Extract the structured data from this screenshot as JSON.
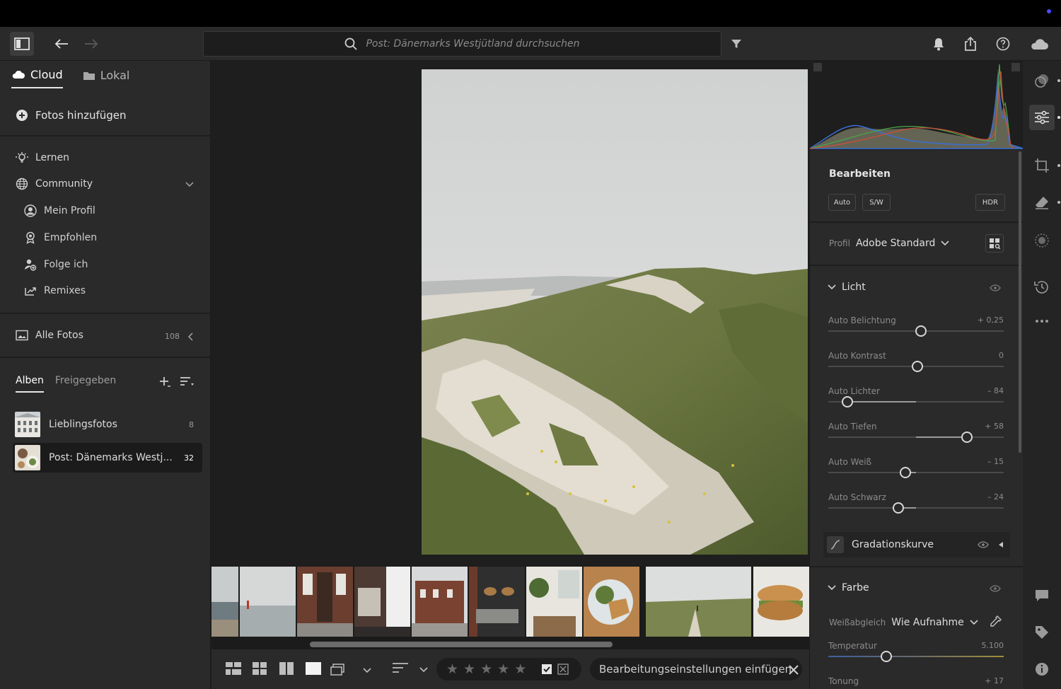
{
  "toolbar": {
    "search_placeholder": "Post: Dänemarks Westjütland durchsuchen"
  },
  "left": {
    "tabs": [
      {
        "label": "Cloud",
        "icon": "cloud-icon",
        "active": true
      },
      {
        "label": "Lokal",
        "icon": "folder-icon",
        "active": false
      }
    ],
    "add_photos": "Fotos hinzufügen",
    "nav": {
      "learn": "Lernen",
      "community": "Community",
      "my_profile": "Mein Profil",
      "recommended": "Empfohlen",
      "following": "Folge ich",
      "remixes": "Remixes",
      "all_photos": "Alle Fotos",
      "all_photos_count": "108"
    },
    "album_tabs": [
      "Alben",
      "Freigegeben"
    ],
    "albums": [
      {
        "name": "Lieblingsfotos",
        "count": "8"
      },
      {
        "name": "Post: Dänemarks Westj...",
        "count": "32"
      }
    ]
  },
  "edit": {
    "title": "Bearbeiten",
    "auto_btn": "Auto",
    "bw_btn": "S/W",
    "hdr_btn": "HDR",
    "profile_label": "Profil",
    "profile_value": "Adobe Standard",
    "light": {
      "title": "Licht",
      "sliders": [
        {
          "label": "Auto Belichtung",
          "value": "+ 0,25",
          "pos": 0.53
        },
        {
          "label": "Auto Kontrast",
          "value": "0",
          "pos": 0.51
        },
        {
          "label": "Auto Lichter",
          "value": "– 84",
          "pos": 0.11
        },
        {
          "label": "Auto Tiefen",
          "value": "+ 58",
          "pos": 0.79
        },
        {
          "label": "Auto Weiß",
          "value": "– 15",
          "pos": 0.44
        },
        {
          "label": "Auto Schwarz",
          "value": "– 24",
          "pos": 0.4
        }
      ]
    },
    "curve_label": "Gradationskurve",
    "color": {
      "title": "Farbe",
      "wb_label": "Weißabgleich",
      "wb_value": "Wie Aufnahme",
      "temp": {
        "label": "Temperatur",
        "value": "5.100",
        "pos": 0.33
      },
      "tint": {
        "label": "Tonung",
        "value": "+ 17"
      }
    }
  },
  "bottom": {
    "paste_settings": "Bearbeitungseinstellungen einfügen",
    "rating_stars": 0
  },
  "colors": {
    "panel": "#2a2a2a",
    "canvas": "#1e1e1e",
    "accent_dot": "#4b4bff"
  }
}
